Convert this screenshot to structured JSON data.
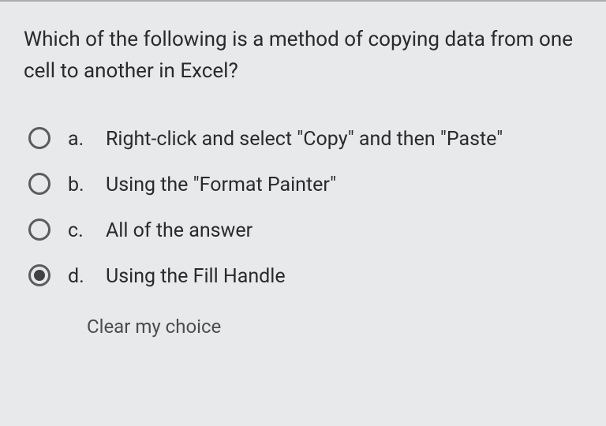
{
  "question": {
    "text": "Which of the following is a method of copying data from one cell to another in Excel?"
  },
  "options": [
    {
      "letter": "a.",
      "text": "Right-click and select \"Copy\" and then \"Paste\"",
      "selected": false
    },
    {
      "letter": "b.",
      "text": "Using the \"Format Painter\"",
      "selected": false
    },
    {
      "letter": "c.",
      "text": "All of the answer",
      "selected": false
    },
    {
      "letter": "d.",
      "text": "Using the Fill Handle",
      "selected": true
    }
  ],
  "clear_label": "Clear my choice"
}
